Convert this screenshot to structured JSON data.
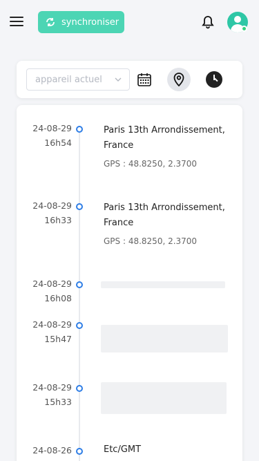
{
  "header": {
    "sync_label": "synchroniser"
  },
  "filters": {
    "device_placeholder": "appareil actuel"
  },
  "timeline": [
    {
      "date": "24-08-29",
      "time": "16h54",
      "place": "Paris 13th Arrondissement, France",
      "gps": "GPS :  48.8250, 2.3700"
    },
    {
      "date": "24-08-29",
      "time": "16h33",
      "place": "Paris 13th Arrondissement, France",
      "gps": "GPS :  48.8250, 2.3700"
    },
    {
      "date": "24-08-29",
      "time": "16h08",
      "place": "",
      "gps": ""
    },
    {
      "date": "24-08-29",
      "time": "15h47",
      "place": "",
      "gps": ""
    },
    {
      "date": "24-08-29",
      "time": "15h33",
      "place": "",
      "gps": ""
    },
    {
      "date": "24-08-26",
      "time": "",
      "place": "Etc/GMT",
      "gps": ""
    }
  ],
  "colors": {
    "accent": "#4cd5b4",
    "timeline_dot": "#2f7ee6",
    "status_online": "#35d07f"
  }
}
